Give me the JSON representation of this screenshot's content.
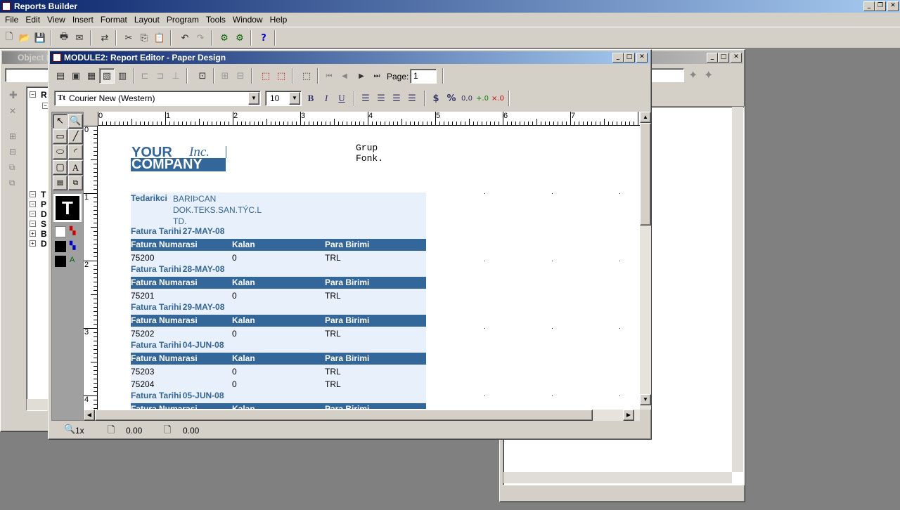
{
  "app": {
    "title": "Reports Builder",
    "menu": [
      "File",
      "Edit",
      "View",
      "Insert",
      "Format",
      "Layout",
      "Program",
      "Tools",
      "Window",
      "Help"
    ]
  },
  "object_nav": {
    "title": "Object N",
    "tree_top": "R",
    "tree_items": [
      "T",
      "P",
      "D",
      "S",
      "B",
      "D"
    ]
  },
  "editor": {
    "title": "MODULE2: Report Editor - Paper Design",
    "page_label": "Page:",
    "page_value": "1",
    "font_name": "Courier New (Western)",
    "font_size": "10",
    "status": {
      "zoom": "1x",
      "x": "0.00",
      "y": "0.00"
    },
    "ruler_h": [
      "0",
      "1",
      "2",
      "3",
      "4",
      "5",
      "6",
      "7"
    ],
    "ruler_v": [
      "0",
      "1",
      "2",
      "3",
      "4"
    ]
  },
  "report": {
    "company_line1": "YOUR",
    "company_inc": "Inc.",
    "company_line2": "COMPANY",
    "header_text": "Grup Fonk.",
    "supplier_label": "Tedarikci",
    "supplier_value_1": "BARIÞCAN",
    "supplier_value_2": "DOK.TEKS.SAN.TÝC.L",
    "supplier_value_3": "TD.",
    "col_invoice": "Fatura Numarasi",
    "col_remaining": "Kalan",
    "col_currency": "Para Birimi",
    "date_label": "Fatura Tarihi",
    "groups": [
      {
        "date": "27-MAY-08",
        "rows": [
          {
            "no": "75200",
            "kalan": "0",
            "para": "TRL"
          }
        ]
      },
      {
        "date": "28-MAY-08",
        "rows": [
          {
            "no": "75201",
            "kalan": "0",
            "para": "TRL"
          }
        ]
      },
      {
        "date": "29-MAY-08",
        "rows": [
          {
            "no": "75202",
            "kalan": "0",
            "para": "TRL"
          }
        ]
      },
      {
        "date": "04-JUN-08",
        "rows": [
          {
            "no": "75203",
            "kalan": "0",
            "para": "TRL"
          },
          {
            "no": "75204",
            "kalan": "0",
            "para": "TRL"
          }
        ]
      },
      {
        "date": "05-JUN-08",
        "rows": []
      }
    ]
  },
  "colors": {
    "header_blue": "#336699",
    "section_bg": "#e8f0fb",
    "title_active": "#0a246a"
  }
}
